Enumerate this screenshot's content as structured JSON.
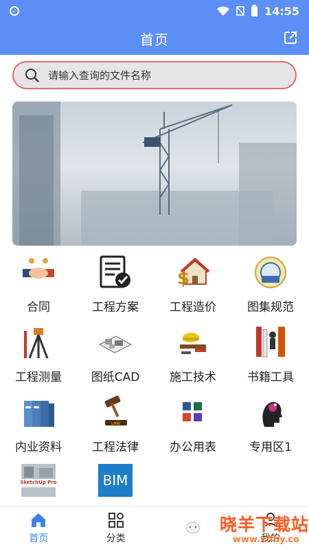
{
  "status_bar": {
    "time": "14:55"
  },
  "app_bar": {
    "title": "首页"
  },
  "search": {
    "placeholder": "请输入查询的文件名称"
  },
  "grid": [
    {
      "label": "合同",
      "icon": "handshake-icon"
    },
    {
      "label": "工程方案",
      "icon": "document-check-icon"
    },
    {
      "label": "工程造价",
      "icon": "house-money-icon"
    },
    {
      "label": "图集规范",
      "icon": "atlas-seal-icon"
    },
    {
      "label": "工程测量",
      "icon": "surveying-tripod-icon"
    },
    {
      "label": "图纸CAD",
      "icon": "cad-drawing-icon"
    },
    {
      "label": "施工技术",
      "icon": "tools-icon"
    },
    {
      "label": "书籍工具",
      "icon": "books-icon"
    },
    {
      "label": "内业资料",
      "icon": "binders-icon"
    },
    {
      "label": "工程法律",
      "icon": "gavel-icon"
    },
    {
      "label": "办公用表",
      "icon": "office-apps-icon"
    },
    {
      "label": "专用区1",
      "icon": "head-idea-icon"
    },
    {
      "label": "",
      "icon": "sketchup-icon",
      "image_text": "SketchUp Pro"
    },
    {
      "label": "",
      "icon": "bim-icon",
      "image_text": "BIM"
    }
  ],
  "tabs": [
    {
      "label": "首页",
      "icon": "home-icon",
      "active": true
    },
    {
      "label": "分类",
      "icon": "category-icon"
    },
    {
      "label": "",
      "icon": "sheep-icon"
    },
    {
      "label": "我的",
      "icon": "user-icon"
    }
  ],
  "watermark": {
    "text": "晓羊下载站",
    "url": "www.xffhy.co"
  },
  "colors": {
    "primary": "#5b8ff5",
    "search_border": "#e26a68",
    "active_tab": "#3b82f0"
  }
}
